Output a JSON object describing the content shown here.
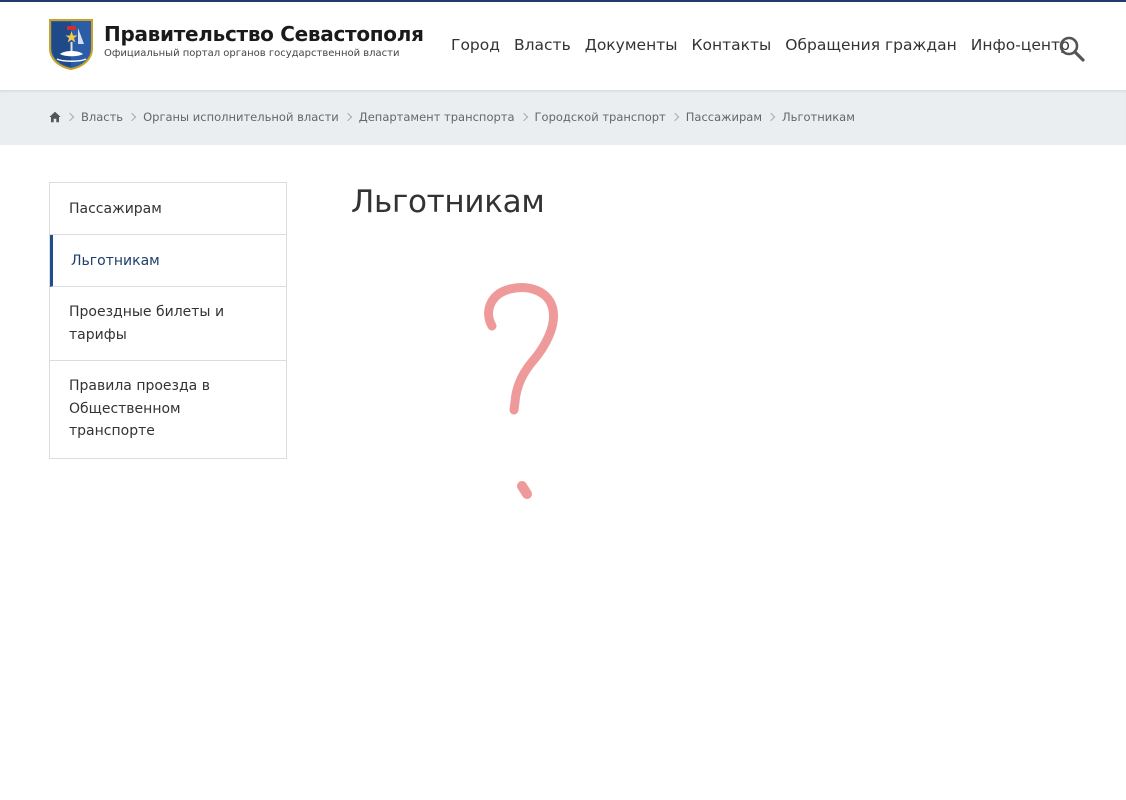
{
  "header": {
    "title": "Правительство Севастополя",
    "subtitle": "Официальный портал органов государственной власти",
    "nav": [
      {
        "label": "Город"
      },
      {
        "label": "Власть"
      },
      {
        "label": "Документы"
      },
      {
        "label": "Контакты"
      },
      {
        "label": "Обращения граждан"
      },
      {
        "label": "Инфо-центр"
      }
    ],
    "search_icon": "search-icon"
  },
  "breadcrumb": {
    "home_icon": "home-icon",
    "items": [
      {
        "label": "Власть"
      },
      {
        "label": "Органы исполнительной власти"
      },
      {
        "label": "Департамент транспорта"
      },
      {
        "label": "Городской транспорт"
      },
      {
        "label": "Пассажирам"
      },
      {
        "label": "Льготникам"
      }
    ]
  },
  "sidebar": {
    "items": [
      {
        "label": "Пассажирам",
        "active": false
      },
      {
        "label": "Льготникам",
        "active": true
      },
      {
        "label": "Проездные билеты и тарифы",
        "active": false
      },
      {
        "label": "Правила проезда в Общественном транспорте",
        "active": false
      }
    ]
  },
  "main": {
    "title": "Льготникам",
    "placeholder_icon": "question-mark-icon"
  },
  "colors": {
    "accent": "#1d4f8a",
    "topline": "#1d3d6b",
    "breadcrumb_bg": "#ebeef1",
    "question_mark": "#ef9a9a"
  }
}
